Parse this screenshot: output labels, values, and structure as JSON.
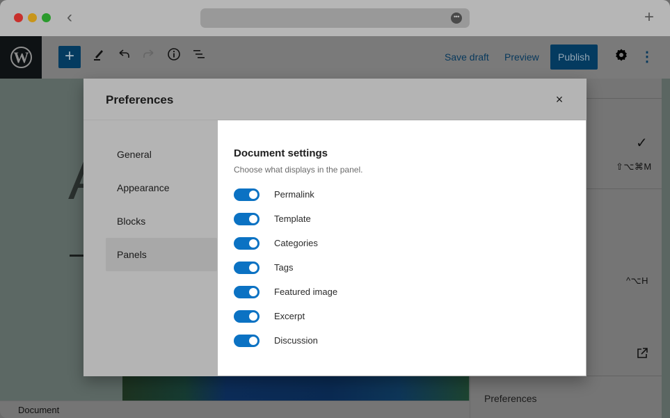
{
  "browser": {
    "back_icon": "chevron-left",
    "url_more_icon": "ellipsis",
    "new_tab_icon": "plus"
  },
  "toolbar": {
    "logo": "W",
    "add_block_icon": "+",
    "tools_icon": "pencil",
    "undo_icon": "undo",
    "redo_icon": "redo",
    "info_icon": "info",
    "list_view_icon": "list",
    "save_draft_label": "Save draft",
    "preview_label": "Preview",
    "publish_label": "Publish",
    "settings_icon": "gear",
    "options_icon": "more-vertical"
  },
  "canvas": {
    "title_fragment": "A"
  },
  "sidebar": {
    "checkmark": "✓",
    "shortcut_1": "⇧⌥⌘M",
    "shortcut_2": "^⌥H",
    "external_icon": "external-link",
    "preferences_label": "Preferences"
  },
  "statusbar": {
    "label": "Document"
  },
  "modal": {
    "title": "Preferences",
    "close_label": "×",
    "nav": [
      {
        "label": "General",
        "active": false
      },
      {
        "label": "Appearance",
        "active": false
      },
      {
        "label": "Blocks",
        "active": false
      },
      {
        "label": "Panels",
        "active": true
      }
    ],
    "section_title": "Document settings",
    "section_description": "Choose what displays in the panel.",
    "toggles": [
      {
        "label": "Permalink",
        "checked": true
      },
      {
        "label": "Template",
        "checked": true
      },
      {
        "label": "Categories",
        "checked": true
      },
      {
        "label": "Tags",
        "checked": true
      },
      {
        "label": "Featured image",
        "checked": true
      },
      {
        "label": "Excerpt",
        "checked": true
      },
      {
        "label": "Discussion",
        "checked": true
      }
    ]
  },
  "colors": {
    "accent": "#0b72c3",
    "publish_bg": "#043b60"
  }
}
